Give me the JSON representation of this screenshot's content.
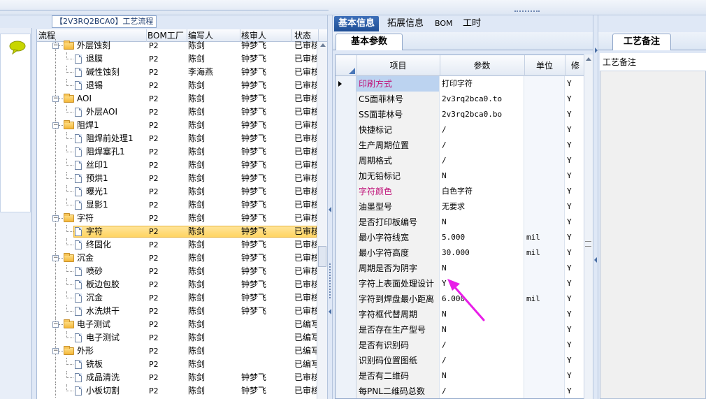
{
  "tree": {
    "title": "【2V3RQ2BCA0】工艺流程",
    "columns": [
      "流程",
      "BOM工厂",
      "编写人",
      "核审人",
      "状态"
    ],
    "rows": [
      {
        "type": "folder",
        "name": "外层蚀刻",
        "plant": "P2",
        "writer": "陈剑",
        "reviewer": "钟梦飞",
        "status": "已审核"
      },
      {
        "type": "doc",
        "name": "退膜",
        "plant": "P2",
        "writer": "陈剑",
        "reviewer": "钟梦飞",
        "status": "已审核"
      },
      {
        "type": "doc",
        "name": "碱性蚀刻",
        "plant": "P2",
        "writer": "李海燕",
        "reviewer": "钟梦飞",
        "status": "已审核"
      },
      {
        "type": "doc",
        "name": "退锡",
        "plant": "P2",
        "writer": "陈剑",
        "reviewer": "钟梦飞",
        "status": "已审核"
      },
      {
        "type": "folder",
        "name": "AOI",
        "plant": "P2",
        "writer": "陈剑",
        "reviewer": "钟梦飞",
        "status": "已审核"
      },
      {
        "type": "doc",
        "name": "外层AOI",
        "plant": "P2",
        "writer": "陈剑",
        "reviewer": "钟梦飞",
        "status": "已审核"
      },
      {
        "type": "folder",
        "name": "阻焊1",
        "plant": "P2",
        "writer": "陈剑",
        "reviewer": "钟梦飞",
        "status": "已审核"
      },
      {
        "type": "doc",
        "name": "阻焊前处理1",
        "plant": "P2",
        "writer": "陈剑",
        "reviewer": "钟梦飞",
        "status": "已审核"
      },
      {
        "type": "doc",
        "name": "阻焊塞孔1",
        "plant": "P2",
        "writer": "陈剑",
        "reviewer": "钟梦飞",
        "status": "已审核"
      },
      {
        "type": "doc",
        "name": "丝印1",
        "plant": "P2",
        "writer": "陈剑",
        "reviewer": "钟梦飞",
        "status": "已审核"
      },
      {
        "type": "doc",
        "name": "预烘1",
        "plant": "P2",
        "writer": "陈剑",
        "reviewer": "钟梦飞",
        "status": "已审核"
      },
      {
        "type": "doc",
        "name": "曝光1",
        "plant": "P2",
        "writer": "陈剑",
        "reviewer": "钟梦飞",
        "status": "已审核"
      },
      {
        "type": "doc",
        "name": "显影1",
        "plant": "P2",
        "writer": "陈剑",
        "reviewer": "钟梦飞",
        "status": "已审核"
      },
      {
        "type": "folder",
        "name": "字符",
        "plant": "P2",
        "writer": "陈剑",
        "reviewer": "钟梦飞",
        "status": "已审核"
      },
      {
        "type": "doc",
        "name": "字符",
        "plant": "P2",
        "writer": "陈剑",
        "reviewer": "钟梦飞",
        "status": "已审核",
        "selected": true
      },
      {
        "type": "doc",
        "name": "终固化",
        "plant": "P2",
        "writer": "陈剑",
        "reviewer": "钟梦飞",
        "status": "已审核"
      },
      {
        "type": "folder",
        "name": "沉金",
        "plant": "P2",
        "writer": "陈剑",
        "reviewer": "钟梦飞",
        "status": "已审核"
      },
      {
        "type": "doc",
        "name": "喷砂",
        "plant": "P2",
        "writer": "陈剑",
        "reviewer": "钟梦飞",
        "status": "已审核"
      },
      {
        "type": "doc",
        "name": "板边包胶",
        "plant": "P2",
        "writer": "陈剑",
        "reviewer": "钟梦飞",
        "status": "已审核"
      },
      {
        "type": "doc",
        "name": "沉金",
        "plant": "P2",
        "writer": "陈剑",
        "reviewer": "钟梦飞",
        "status": "已审核"
      },
      {
        "type": "doc",
        "name": "水洗烘干",
        "plant": "P2",
        "writer": "陈剑",
        "reviewer": "钟梦飞",
        "status": "已审核"
      },
      {
        "type": "folder",
        "name": "电子测试",
        "plant": "P2",
        "writer": "陈剑",
        "reviewer": "",
        "status": "已编写"
      },
      {
        "type": "doc",
        "name": "电子测试",
        "plant": "P2",
        "writer": "陈剑",
        "reviewer": "",
        "status": "已编写"
      },
      {
        "type": "folder",
        "name": "外形",
        "plant": "P2",
        "writer": "陈剑",
        "reviewer": "",
        "status": "已编写"
      },
      {
        "type": "doc",
        "name": "铣板",
        "plant": "P2",
        "writer": "陈剑",
        "reviewer": "",
        "status": "已编写"
      },
      {
        "type": "doc",
        "name": "成品清洗",
        "plant": "P2",
        "writer": "陈剑",
        "reviewer": "钟梦飞",
        "status": "已审核"
      },
      {
        "type": "doc",
        "name": "小板切割",
        "plant": "P2",
        "writer": "陈剑",
        "reviewer": "钟梦飞",
        "status": "已审核"
      }
    ]
  },
  "main_tabs": [
    "基本信息",
    "拓展信息",
    "BOM",
    "工时"
  ],
  "active_tab": "基本信息",
  "subtab": "基本参数",
  "grid": {
    "columns": [
      "项目",
      "参数",
      "单位",
      "修"
    ],
    "rows": [
      {
        "item": "印刷方式",
        "param": "打印字符",
        "unit": "",
        "flag": "Y",
        "highlight": true,
        "current": true
      },
      {
        "item": "CS面菲林号",
        "param": "2v3rq2bca0.to",
        "unit": "",
        "flag": "Y"
      },
      {
        "item": "SS面菲林号",
        "param": "2v3rq2bca0.bo",
        "unit": "",
        "flag": "Y"
      },
      {
        "item": "快捷标记",
        "param": "/",
        "unit": "",
        "flag": "Y"
      },
      {
        "item": "生产周期位置",
        "param": "/",
        "unit": "",
        "flag": "Y"
      },
      {
        "item": "周期格式",
        "param": "/",
        "unit": "",
        "flag": "Y"
      },
      {
        "item": "加无铅标记",
        "param": "N",
        "unit": "",
        "flag": "Y"
      },
      {
        "item": "字符颜色",
        "param": "白色字符",
        "unit": "",
        "flag": "Y",
        "highlight": true
      },
      {
        "item": "油墨型号",
        "param": "无要求",
        "unit": "",
        "flag": "Y"
      },
      {
        "item": "是否打印板编号",
        "param": "N",
        "unit": "",
        "flag": "Y"
      },
      {
        "item": "最小字符线宽",
        "param": "5.000",
        "unit": "mil",
        "flag": "Y"
      },
      {
        "item": "最小字符高度",
        "param": "30.000",
        "unit": "mil",
        "flag": "Y"
      },
      {
        "item": "周期是否为阴字",
        "param": "N",
        "unit": "",
        "flag": "Y"
      },
      {
        "item": "字符上表面处理设计",
        "param": "Y",
        "unit": "",
        "flag": "Y"
      },
      {
        "item": "字符到焊盘最小距离",
        "param": "6.000",
        "unit": "mil",
        "flag": "Y"
      },
      {
        "item": "字符框代替周期",
        "param": "N",
        "unit": "",
        "flag": "Y"
      },
      {
        "item": "是否存在生产型号",
        "param": "N",
        "unit": "",
        "flag": "Y"
      },
      {
        "item": "是否有识别码",
        "param": "/",
        "unit": "",
        "flag": "Y"
      },
      {
        "item": "识别码位置图纸",
        "param": "/",
        "unit": "",
        "flag": "Y"
      },
      {
        "item": "是否有二维码",
        "param": "N",
        "unit": "",
        "flag": "Y"
      },
      {
        "item": "每PNL二维码总数",
        "param": "/",
        "unit": "",
        "flag": "Y"
      }
    ]
  },
  "notes": {
    "tab": "工艺备注",
    "label": "工艺备注"
  },
  "colors": {
    "highlight_text": "#c0157a",
    "active_tab": "#2a5aa3",
    "selection": "#ffd462",
    "annotation_arrow": "#e81ee8"
  },
  "icons": {
    "chat": "speech-bubble-icon",
    "folder": "folder-icon",
    "doc": "document-icon"
  }
}
